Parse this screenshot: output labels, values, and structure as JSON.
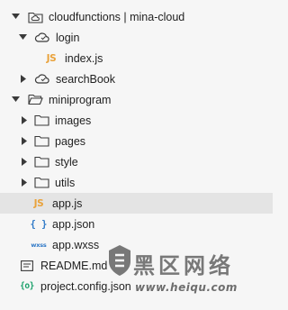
{
  "tree": {
    "cloudfunctions_label": "cloudfunctions | mina-cloud",
    "login_label": "login",
    "index_js_label": "index.js",
    "searchbook_label": "searchBook",
    "miniprogram_label": "miniprogram",
    "images_label": "images",
    "pages_label": "pages",
    "style_label": "style",
    "utils_label": "utils",
    "app_js_label": "app.js",
    "app_json_label": "app.json",
    "app_wxss_label": "app.wxss",
    "readme_label": "README.md",
    "project_config_label": "project.config.json",
    "selected_item": "app.js"
  },
  "icons": {
    "js_glyph": "JS",
    "json_glyph": "{ }",
    "wxss_glyph": "wxss",
    "config_glyph": "{o}"
  },
  "watermark": {
    "title": "黑区网络",
    "url": "www.heiqu.com"
  },
  "colors": {
    "background": "#f6f6f6",
    "selected_row": "#e4e4e4",
    "js_icon": "#e9a23b",
    "json_icon": "#2e78c7",
    "config_icon": "#1aa06a"
  }
}
